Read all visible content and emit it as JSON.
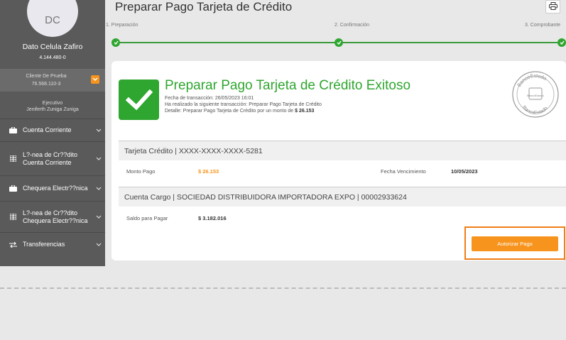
{
  "sidebar": {
    "avatar_initials": "DC",
    "user_name": "Dato Celula Zafiro",
    "user_rut": "4.144.480-0",
    "client_name": "Cliente De Prueba",
    "client_rut": "76.568.110-3",
    "executive_label": "Ejecutivo",
    "executive_name": "Jeniferth Zuniga Zuniga",
    "menu": [
      {
        "icon": "briefcase-icon",
        "label": "Cuenta Corriente"
      },
      {
        "icon": "grid-icon",
        "label": "L?-nea de Cr??dito Cuenta Corriente"
      },
      {
        "icon": "briefcase-icon",
        "label": "Chequera Electr??nica"
      },
      {
        "icon": "grid-icon",
        "label": "L?-nea de Cr??dito Chequera Electr??nica"
      },
      {
        "icon": "transfer-icon",
        "label": "Transferencias"
      }
    ]
  },
  "header": {
    "title": "Preparar Pago Tarjeta de Crédito",
    "print_icon": "print-icon"
  },
  "steps": [
    "1. Preparación",
    "2. Confirmación",
    "3. Comprobante"
  ],
  "success": {
    "title": "Preparar Pago Tarjeta de Crédito Exitoso",
    "line1": "Fecha de transacción: 26/05/2023 16:01",
    "line2": "Ha realizado la siguiente transacción: Preparar Pago Tarjeta de Crédito",
    "line3_prefix": "Detalle: Preparar Pago Tarjeta de Crédito por un monto de",
    "line3_amount": "$ 26.153",
    "stamp_text_top": "BancoEstado",
    "stamp_text_mid": "BancoEstado",
    "stamp_text_bottom": "BancoEstado"
  },
  "card_section": {
    "header": "Tarjeta Crédito | XXXX-XXXX-XXXX-5281",
    "monto_label": "Monto Pago",
    "monto_value": "$ 26.153",
    "vencimiento_label": "Fecha Vencimiento",
    "vencimiento_value": "10/05/2023"
  },
  "account_section": {
    "header": "Cuenta Cargo | SOCIEDAD DISTRIBUIDORA IMPORTADORA EXPO | 00002933624",
    "saldo_label": "Saldo para Pagar",
    "saldo_value": "$ 3.182.016"
  },
  "actions": {
    "authorize_label": "Autorizar Pago"
  },
  "colors": {
    "success_green": "#2fa62f",
    "accent_orange": "#f7941d",
    "sidebar_bg": "#5a5a5a"
  }
}
